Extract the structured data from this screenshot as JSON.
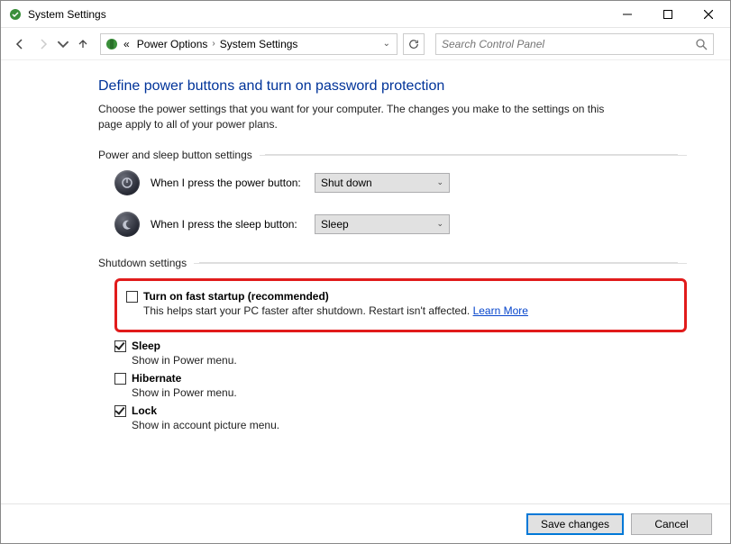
{
  "window": {
    "title": "System Settings"
  },
  "breadcrumb": {
    "prefix": "«",
    "item1": "Power Options",
    "item2": "System Settings"
  },
  "search": {
    "placeholder": "Search Control Panel"
  },
  "heading": "Define power buttons and turn on password protection",
  "description": "Choose the power settings that you want for your computer. The changes you make to the settings on this page apply to all of your power plans.",
  "section_power_sleep": {
    "title": "Power and sleep button settings",
    "power_button": {
      "label": "When I press the power button:",
      "value": "Shut down"
    },
    "sleep_button": {
      "label": "When I press the sleep button:",
      "value": "Sleep"
    }
  },
  "section_shutdown": {
    "title": "Shutdown settings",
    "fast_startup": {
      "label": "Turn on fast startup (recommended)",
      "desc": "This helps start your PC faster after shutdown. Restart isn't affected. ",
      "learn_more": "Learn More"
    },
    "sleep": {
      "label": "Sleep",
      "desc": "Show in Power menu."
    },
    "hibernate": {
      "label": "Hibernate",
      "desc": "Show in Power menu."
    },
    "lock": {
      "label": "Lock",
      "desc": "Show in account picture menu."
    }
  },
  "footer": {
    "save": "Save changes",
    "cancel": "Cancel"
  }
}
